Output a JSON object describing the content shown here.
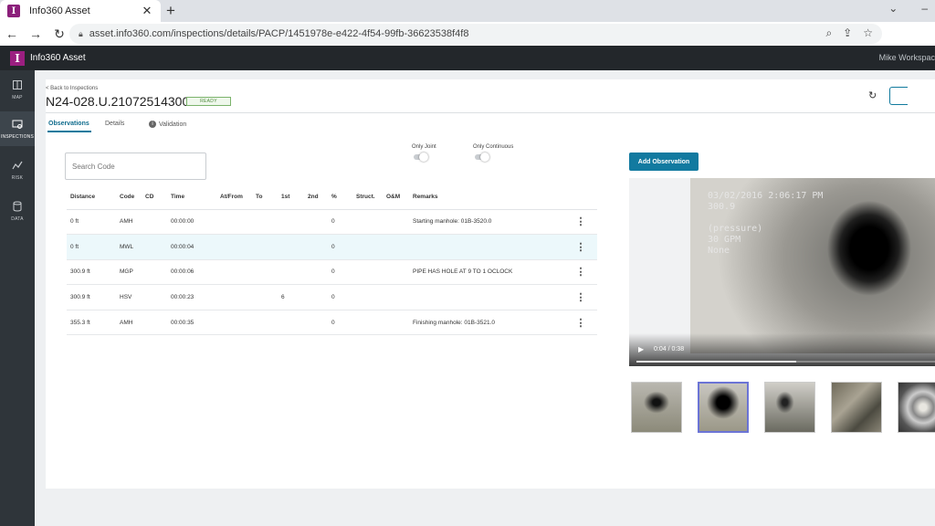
{
  "browser": {
    "tab_title": "Info360 Asset",
    "tab_favicon_letter": "I",
    "url": "asset.info360.com/inspections/details/PACP/1451978e-e422-4f54-99fb-36623538f4f8"
  },
  "app": {
    "logo_letter": "I",
    "title": "Info360 Asset",
    "user_workspace": "Mike Workspac"
  },
  "sidebar": {
    "items": [
      {
        "label": "MAP",
        "icon": "book-map-icon"
      },
      {
        "label": "INSPECTIONS",
        "icon": "inspections-icon"
      },
      {
        "label": "RISK",
        "icon": "risk-icon"
      },
      {
        "label": "DATA",
        "icon": "database-icon"
      }
    ]
  },
  "inspection": {
    "back_link": "< Back to Inspections",
    "title": "N24-028.U.210725143000",
    "status": "READY"
  },
  "tabs": [
    {
      "label": "Observations",
      "active": true
    },
    {
      "label": "Details",
      "active": false
    },
    {
      "label": "Validation",
      "active": false,
      "info_icon": "i"
    }
  ],
  "search": {
    "placeholder": "Search Code"
  },
  "toggles": {
    "only_joint": "Only Joint",
    "only_continuous": "Only Continuous"
  },
  "add_observation_label": "Add Observation",
  "table": {
    "columns": [
      "Distance",
      "Code",
      "CD",
      "Time",
      "At/From",
      "To",
      "1st",
      "2nd",
      "%",
      "Struct.",
      "O&M",
      "Remarks"
    ],
    "rows": [
      {
        "distance": "0 ft",
        "code": "AMH",
        "cd": "",
        "time": "00:00:00",
        "at_from": "",
        "to": "",
        "first": "",
        "second": "",
        "percent": "0",
        "struct": "",
        "om": "",
        "remarks": "Starting manhole: 01B-3520.0",
        "selected": false
      },
      {
        "distance": "0 ft",
        "code": "MWL",
        "cd": "",
        "time": "00:00:04",
        "at_from": "",
        "to": "",
        "first": "",
        "second": "",
        "percent": "0",
        "struct": "",
        "om": "",
        "remarks": "",
        "selected": true
      },
      {
        "distance": "300.9 ft",
        "code": "MGP",
        "cd": "",
        "time": "00:00:06",
        "at_from": "",
        "to": "",
        "first": "",
        "second": "",
        "percent": "0",
        "struct": "",
        "om": "",
        "remarks": "PIPE HAS HOLE AT 9 TO 1 OCLOCK",
        "selected": false
      },
      {
        "distance": "300.9 ft",
        "code": "HSV",
        "cd": "",
        "time": "00:00:23",
        "at_from": "",
        "to": "",
        "first": "6",
        "second": "",
        "percent": "0",
        "struct": "",
        "om": "",
        "remarks": "",
        "selected": false
      },
      {
        "distance": "355.3 ft",
        "code": "AMH",
        "cd": "",
        "time": "00:00:35",
        "at_from": "",
        "to": "",
        "first": "",
        "second": "",
        "percent": "0",
        "struct": "",
        "om": "",
        "remarks": "Finishing manhole: 01B-3521.0",
        "selected": false
      }
    ]
  },
  "video": {
    "overlay_text": "03/02/2016 2:06:17 PM\n300.9\n\n(pressure)\n30 GPM\nNone",
    "time": "0:04 / 0:38",
    "progress": 0.53
  },
  "thumbnails": [
    {
      "selected": false
    },
    {
      "selected": true
    },
    {
      "selected": false
    },
    {
      "selected": false
    },
    {
      "selected": false
    }
  ]
}
